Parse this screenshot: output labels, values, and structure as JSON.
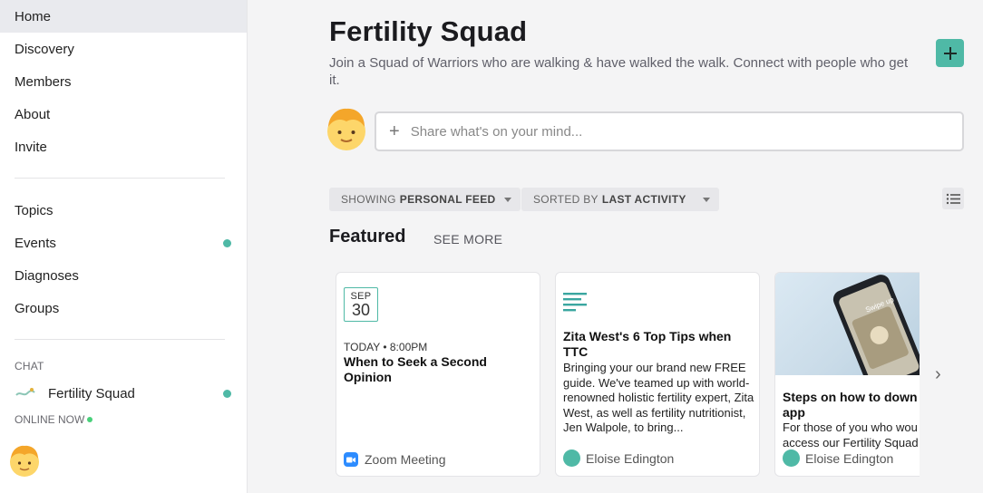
{
  "sidebar": {
    "nav": [
      {
        "label": "Home"
      },
      {
        "label": "Discovery"
      },
      {
        "label": "Members"
      },
      {
        "label": "About"
      },
      {
        "label": "Invite"
      }
    ],
    "nav2": [
      {
        "label": "Topics"
      },
      {
        "label": "Events"
      },
      {
        "label": "Diagnoses"
      },
      {
        "label": "Groups"
      }
    ],
    "chat_label": "CHAT",
    "chat_item": "Fertility Squad",
    "online_label": "ONLINE NOW"
  },
  "main": {
    "title": "Fertility Squad",
    "subtitle": "Join a Squad of Warriors who are walking & have walked the walk. Connect with people who get it.",
    "composer_placeholder": "Share what's on your mind...",
    "filter1_prefix": "SHOWING",
    "filter1_value": "PERSONAL FEED",
    "filter2_prefix": "SORTED BY",
    "filter2_value": "LAST ACTIVITY",
    "featured_label": "Featured",
    "see_more": "SEE MORE"
  },
  "cards": {
    "event": {
      "month": "SEP",
      "day": "30",
      "time": "TODAY • 8:00PM",
      "title": "When to Seek a Second Opinion",
      "footer": "Zoom Meeting"
    },
    "article": {
      "title": "Zita West's 6 Top Tips when TTC",
      "text": "Bringing your our brand new FREE guide. We've teamed up with world-renowned holistic fertility expert, Zita West, as well as fertility nutritionist, Jen Walpole, to bring...",
      "author": "Eloise Edington"
    },
    "app": {
      "title": "Steps on how to down",
      "title_line2": "app",
      "text_line1": "For those of you who wou",
      "text_line2": "access our Fertility Squad",
      "author": "Eloise Edington",
      "phone_text": "Swipe up"
    }
  },
  "colors": {
    "accent": "#4fb9a6",
    "online": "#48d07a",
    "zoom": "#2d8cff"
  }
}
